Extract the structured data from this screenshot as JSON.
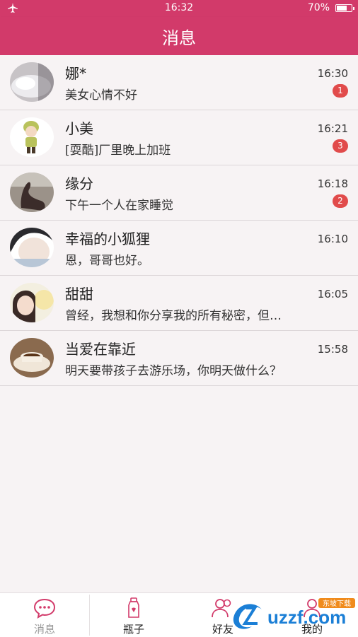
{
  "status_bar": {
    "time": "16:32",
    "battery_pct": "70%",
    "battery_level": 0.7
  },
  "header": {
    "title": "消息"
  },
  "conversations": [
    {
      "name": "娜*",
      "preview": "美女心情不好",
      "time": "16:30",
      "unread": "1"
    },
    {
      "name": "小美",
      "preview": "[耍酷]厂里晚上加班",
      "time": "16:21",
      "unread": "3"
    },
    {
      "name": "缘分",
      "preview": "下午一个人在家睡觉",
      "time": "16:18",
      "unread": "2"
    },
    {
      "name": "幸福的小狐狸",
      "preview": "恩，哥哥也好。",
      "time": "16:10",
      "unread": ""
    },
    {
      "name": "甜甜",
      "preview": "曾经，我想和你分享我的所有秘密，但…",
      "time": "16:05",
      "unread": ""
    },
    {
      "name": "当爱在靠近",
      "preview": "明天要带孩子去游乐场，你明天做什么？",
      "time": "15:58",
      "unread": ""
    }
  ],
  "tabs": [
    {
      "label": "消息",
      "icon": "chat-bubble-icon",
      "active": true
    },
    {
      "label": "瓶子",
      "icon": "bottle-icon",
      "active": false
    },
    {
      "label": "好友",
      "icon": "friends-icon",
      "active": false
    },
    {
      "label": "我的",
      "icon": "profile-icon",
      "active": false
    }
  ],
  "watermark": {
    "text": "uzzf.com",
    "sub": "东坡下载"
  },
  "colors": {
    "brand": "#d23a6a",
    "badge": "#e14b4b",
    "background": "#f7f3f4"
  }
}
